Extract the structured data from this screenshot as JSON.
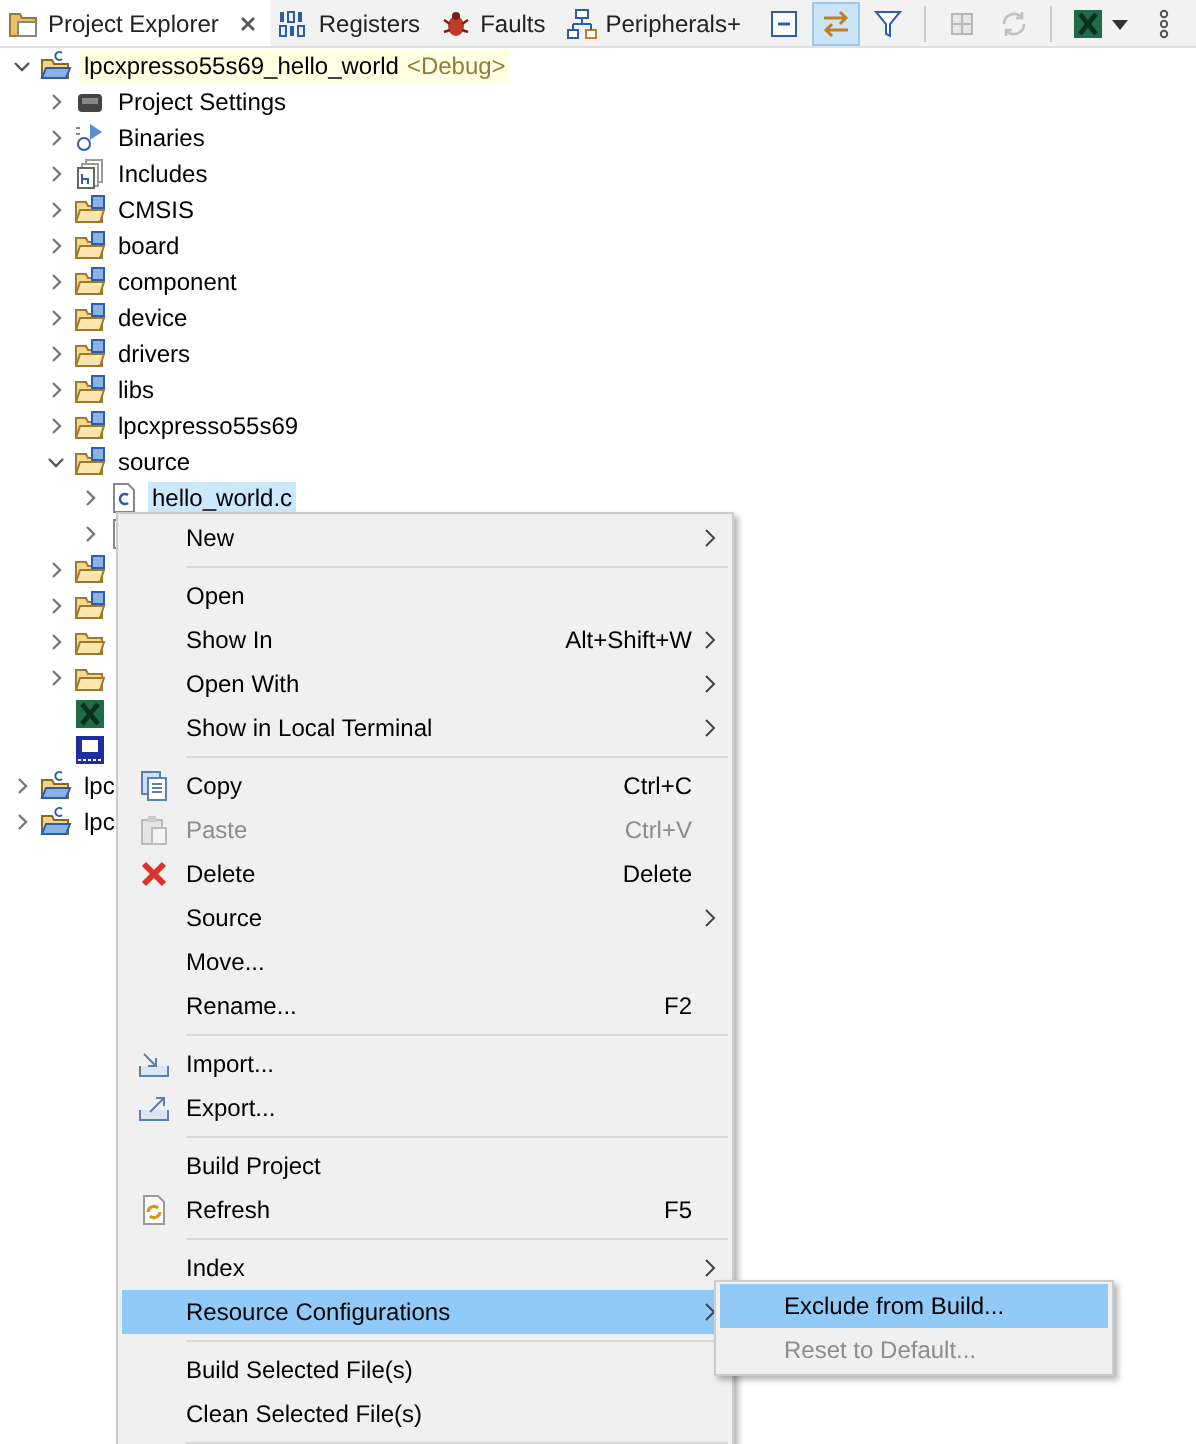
{
  "tabs": [
    {
      "label": "Project Explorer",
      "kind": "explorer",
      "selected": true
    },
    {
      "label": "Registers",
      "kind": "registers",
      "selected": false
    },
    {
      "label": "Faults",
      "kind": "faults",
      "selected": false
    },
    {
      "label": "Peripherals+",
      "kind": "peripherals",
      "selected": false
    }
  ],
  "toolbar": [
    {
      "kind": "collapse",
      "pressed": false,
      "disabled": false
    },
    {
      "kind": "link",
      "pressed": true,
      "disabled": false
    },
    {
      "kind": "filter",
      "pressed": false,
      "disabled": false
    },
    {
      "kind": "separator"
    },
    {
      "kind": "grid",
      "pressed": false,
      "disabled": true
    },
    {
      "kind": "sync",
      "pressed": false,
      "disabled": true
    },
    {
      "kind": "separator"
    },
    {
      "kind": "launch",
      "pressed": false,
      "disabled": false
    },
    {
      "kind": "more",
      "pressed": false,
      "disabled": false
    }
  ],
  "tree": [
    {
      "kind": "project",
      "label": "lpcxpresso55s69_hello_world",
      "decoration": "<Debug>",
      "active": true,
      "expanded": true,
      "selected": false,
      "children": [
        {
          "kind": "settings",
          "label": "Project Settings",
          "expanded": false,
          "selected": false
        },
        {
          "kind": "binaries",
          "label": "Binaries",
          "expanded": false,
          "selected": false
        },
        {
          "kind": "includes",
          "label": "Includes",
          "expanded": false,
          "selected": false
        },
        {
          "kind": "source-folder",
          "label": "CMSIS",
          "expanded": false,
          "selected": false
        },
        {
          "kind": "source-folder",
          "label": "board",
          "expanded": false,
          "selected": false
        },
        {
          "kind": "source-folder",
          "label": "component",
          "expanded": false,
          "selected": false
        },
        {
          "kind": "source-folder",
          "label": "device",
          "expanded": false,
          "selected": false
        },
        {
          "kind": "source-folder",
          "label": "drivers",
          "expanded": false,
          "selected": false
        },
        {
          "kind": "source-folder",
          "label": "libs",
          "expanded": false,
          "selected": false
        },
        {
          "kind": "source-folder",
          "label": "lpcxpresso55s69",
          "expanded": false,
          "selected": false
        },
        {
          "kind": "source-folder",
          "label": "source",
          "expanded": true,
          "selected": false,
          "children": [
            {
              "kind": "c-file",
              "label": "hello_world.c",
              "expanded": false,
              "selected": true
            },
            {
              "kind": "h-file",
              "expanded": false
            }
          ]
        },
        {
          "kind": "source-folder",
          "expanded": false
        },
        {
          "kind": "source-folder",
          "expanded": false
        },
        {
          "kind": "folder",
          "expanded": false
        },
        {
          "kind": "folder",
          "expanded": false
        },
        {
          "kind": "config"
        },
        {
          "kind": "chip"
        }
      ]
    },
    {
      "kind": "project",
      "label": "lpc",
      "active": false,
      "expanded": false,
      "selected": false
    },
    {
      "kind": "project",
      "label": "lpc",
      "active": false,
      "expanded": false,
      "selected": false
    }
  ],
  "context_menu": [
    {
      "kind": "item",
      "label": "New",
      "submenu": true,
      "disabled": false,
      "selected": false
    },
    {
      "kind": "separator"
    },
    {
      "kind": "item",
      "label": "Open",
      "submenu": false,
      "disabled": false,
      "selected": false
    },
    {
      "kind": "item",
      "label": "Show In",
      "shortcut": "Alt+Shift+W",
      "submenu": true,
      "disabled": false,
      "selected": false
    },
    {
      "kind": "item",
      "label": "Open With",
      "submenu": true,
      "disabled": false,
      "selected": false
    },
    {
      "kind": "item",
      "label": "Show in Local Terminal",
      "submenu": true,
      "disabled": false,
      "selected": false
    },
    {
      "kind": "separator"
    },
    {
      "kind": "copy",
      "label": "Copy",
      "shortcut": "Ctrl+C",
      "submenu": false,
      "disabled": false,
      "selected": false
    },
    {
      "kind": "paste",
      "label": "Paste",
      "shortcut": "Ctrl+V",
      "submenu": false,
      "disabled": true,
      "selected": false
    },
    {
      "kind": "delete",
      "label": "Delete",
      "shortcut": "Delete",
      "submenu": false,
      "disabled": false,
      "selected": false
    },
    {
      "kind": "item",
      "label": "Source",
      "submenu": true,
      "disabled": false,
      "selected": false
    },
    {
      "kind": "item",
      "label": "Move...",
      "submenu": false,
      "disabled": false,
      "selected": false
    },
    {
      "kind": "item",
      "label": "Rename...",
      "shortcut": "F2",
      "submenu": false,
      "disabled": false,
      "selected": false
    },
    {
      "kind": "separator"
    },
    {
      "kind": "import",
      "label": "Import...",
      "submenu": false,
      "disabled": false,
      "selected": false
    },
    {
      "kind": "export",
      "label": "Export...",
      "submenu": false,
      "disabled": false,
      "selected": false
    },
    {
      "kind": "separator"
    },
    {
      "kind": "item",
      "label": "Build Project",
      "submenu": false,
      "disabled": false,
      "selected": false
    },
    {
      "kind": "refresh",
      "label": "Refresh",
      "shortcut": "F5",
      "submenu": false,
      "disabled": false,
      "selected": false
    },
    {
      "kind": "separator"
    },
    {
      "kind": "item",
      "label": "Index",
      "submenu": true,
      "disabled": false,
      "selected": false
    },
    {
      "kind": "item",
      "label": "Resource Configurations",
      "submenu": true,
      "disabled": false,
      "selected": true
    },
    {
      "kind": "separator"
    },
    {
      "kind": "item",
      "label": "Build Selected File(s)",
      "submenu": false,
      "disabled": false,
      "selected": false
    },
    {
      "kind": "item",
      "label": "Clean Selected File(s)",
      "submenu": false,
      "disabled": false,
      "selected": false
    },
    {
      "kind": "separator"
    }
  ],
  "submenu": [
    {
      "label": "Exclude from Build...",
      "disabled": false,
      "selected": true
    },
    {
      "label": "Reset to Default...",
      "disabled": true,
      "selected": false
    }
  ]
}
